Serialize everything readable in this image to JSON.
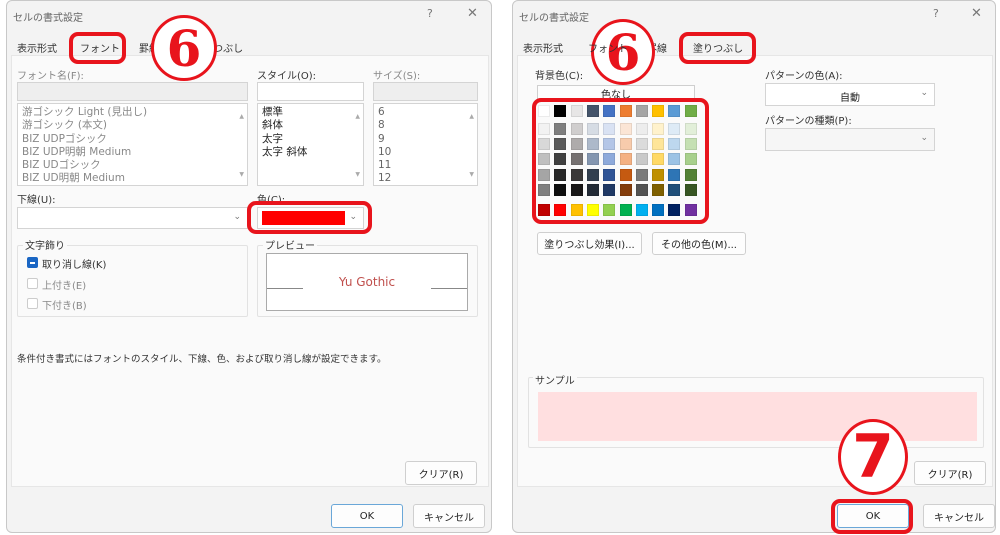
{
  "left": {
    "title": "セルの書式設定",
    "help": "?",
    "close": "✕",
    "tabs": [
      "表示形式",
      "フォント",
      "罫線",
      "塗りつぶし"
    ],
    "active_tab": "フォント",
    "font_name_label": "フォント名(F):",
    "font_list": [
      "游ゴシック Light (見出し)",
      "游ゴシック (本文)",
      "BIZ UDPゴシック",
      "BIZ UDP明朝 Medium",
      "BIZ UDゴシック",
      "BIZ UD明朝 Medium"
    ],
    "style_label": "スタイル(O):",
    "style_list": [
      "標準",
      "斜体",
      "太字",
      "太字 斜体"
    ],
    "size_label": "サイズ(S):",
    "size_list": [
      "6",
      "8",
      "9",
      "10",
      "11",
      "12"
    ],
    "underline_label": "下線(U):",
    "color_label": "色(C):",
    "color_value": "#ff0000",
    "effects_label": "文字飾り",
    "effects": [
      {
        "label": "取り消し線(K)",
        "checked": "indeterminate"
      },
      {
        "label": "上付き(E)",
        "checked": false
      },
      {
        "label": "下付き(B)",
        "checked": false
      }
    ],
    "preview_label": "プレビュー",
    "preview_text": "Yu Gothic",
    "note": "条件付き書式にはフォントのスタイル、下線、色、および取り消し線が設定できます。",
    "clear": "クリア(R)",
    "ok": "OK",
    "cancel": "キャンセル",
    "step_badge": "6"
  },
  "right": {
    "title": "セルの書式設定",
    "help": "?",
    "close": "✕",
    "tabs": [
      "表示形式",
      "フォント",
      "罫線",
      "塗りつぶし"
    ],
    "active_tab": "塗りつぶし",
    "bg_label": "背景色(C):",
    "no_color": "色なし",
    "theme_colors": [
      [
        "#FFFFFF",
        "#000000",
        "#E7E6E6",
        "#44546A",
        "#4472C4",
        "#ED7D31",
        "#A5A5A5",
        "#FFC000",
        "#5B9BD5",
        "#70AD47"
      ],
      [
        "#F2F2F2",
        "#7F7F7F",
        "#D0CECE",
        "#D6DCE4",
        "#D9E2F3",
        "#FBE5D5",
        "#EDEDED",
        "#FFF2CC",
        "#DEEBF6",
        "#E2EFD9"
      ],
      [
        "#D8D8D8",
        "#595959",
        "#AEABAB",
        "#ADB9CA",
        "#B4C6E7",
        "#F7CBAC",
        "#DBDBDB",
        "#FEE599",
        "#BDD7EE",
        "#C5E0B3"
      ],
      [
        "#BFBFBF",
        "#3F3F3F",
        "#757070",
        "#8496B0",
        "#8EAADB",
        "#F4B183",
        "#C9C9C9",
        "#FFD965",
        "#9CC3E5",
        "#A8D08D"
      ],
      [
        "#A5A5A5",
        "#262626",
        "#3A3838",
        "#323F4F",
        "#2F5496",
        "#C55A11",
        "#7B7B7B",
        "#BF9000",
        "#2E75B5",
        "#538135"
      ],
      [
        "#7F7F7F",
        "#0C0C0C",
        "#171616",
        "#222A35",
        "#1F3864",
        "#833C0B",
        "#525252",
        "#7F6000",
        "#1E4E79",
        "#375623"
      ]
    ],
    "standard_colors": [
      "#C00000",
      "#FF0000",
      "#FFC000",
      "#FFFF00",
      "#92D050",
      "#00B050",
      "#00B0F0",
      "#0070C0",
      "#002060",
      "#7030A0"
    ],
    "fill_effects": "塗りつぶし効果(I)...",
    "more_colors": "その他の色(M)...",
    "pattern_color_label": "パターンの色(A):",
    "pattern_color_value": "自動",
    "pattern_type_label": "パターンの種類(P):",
    "sample_label": "サンプル",
    "sample_color": "#FFDFE0",
    "clear": "クリア(R)",
    "ok": "OK",
    "cancel": "キャンセル",
    "step_badge_6": "6",
    "step_badge_7": "7"
  }
}
